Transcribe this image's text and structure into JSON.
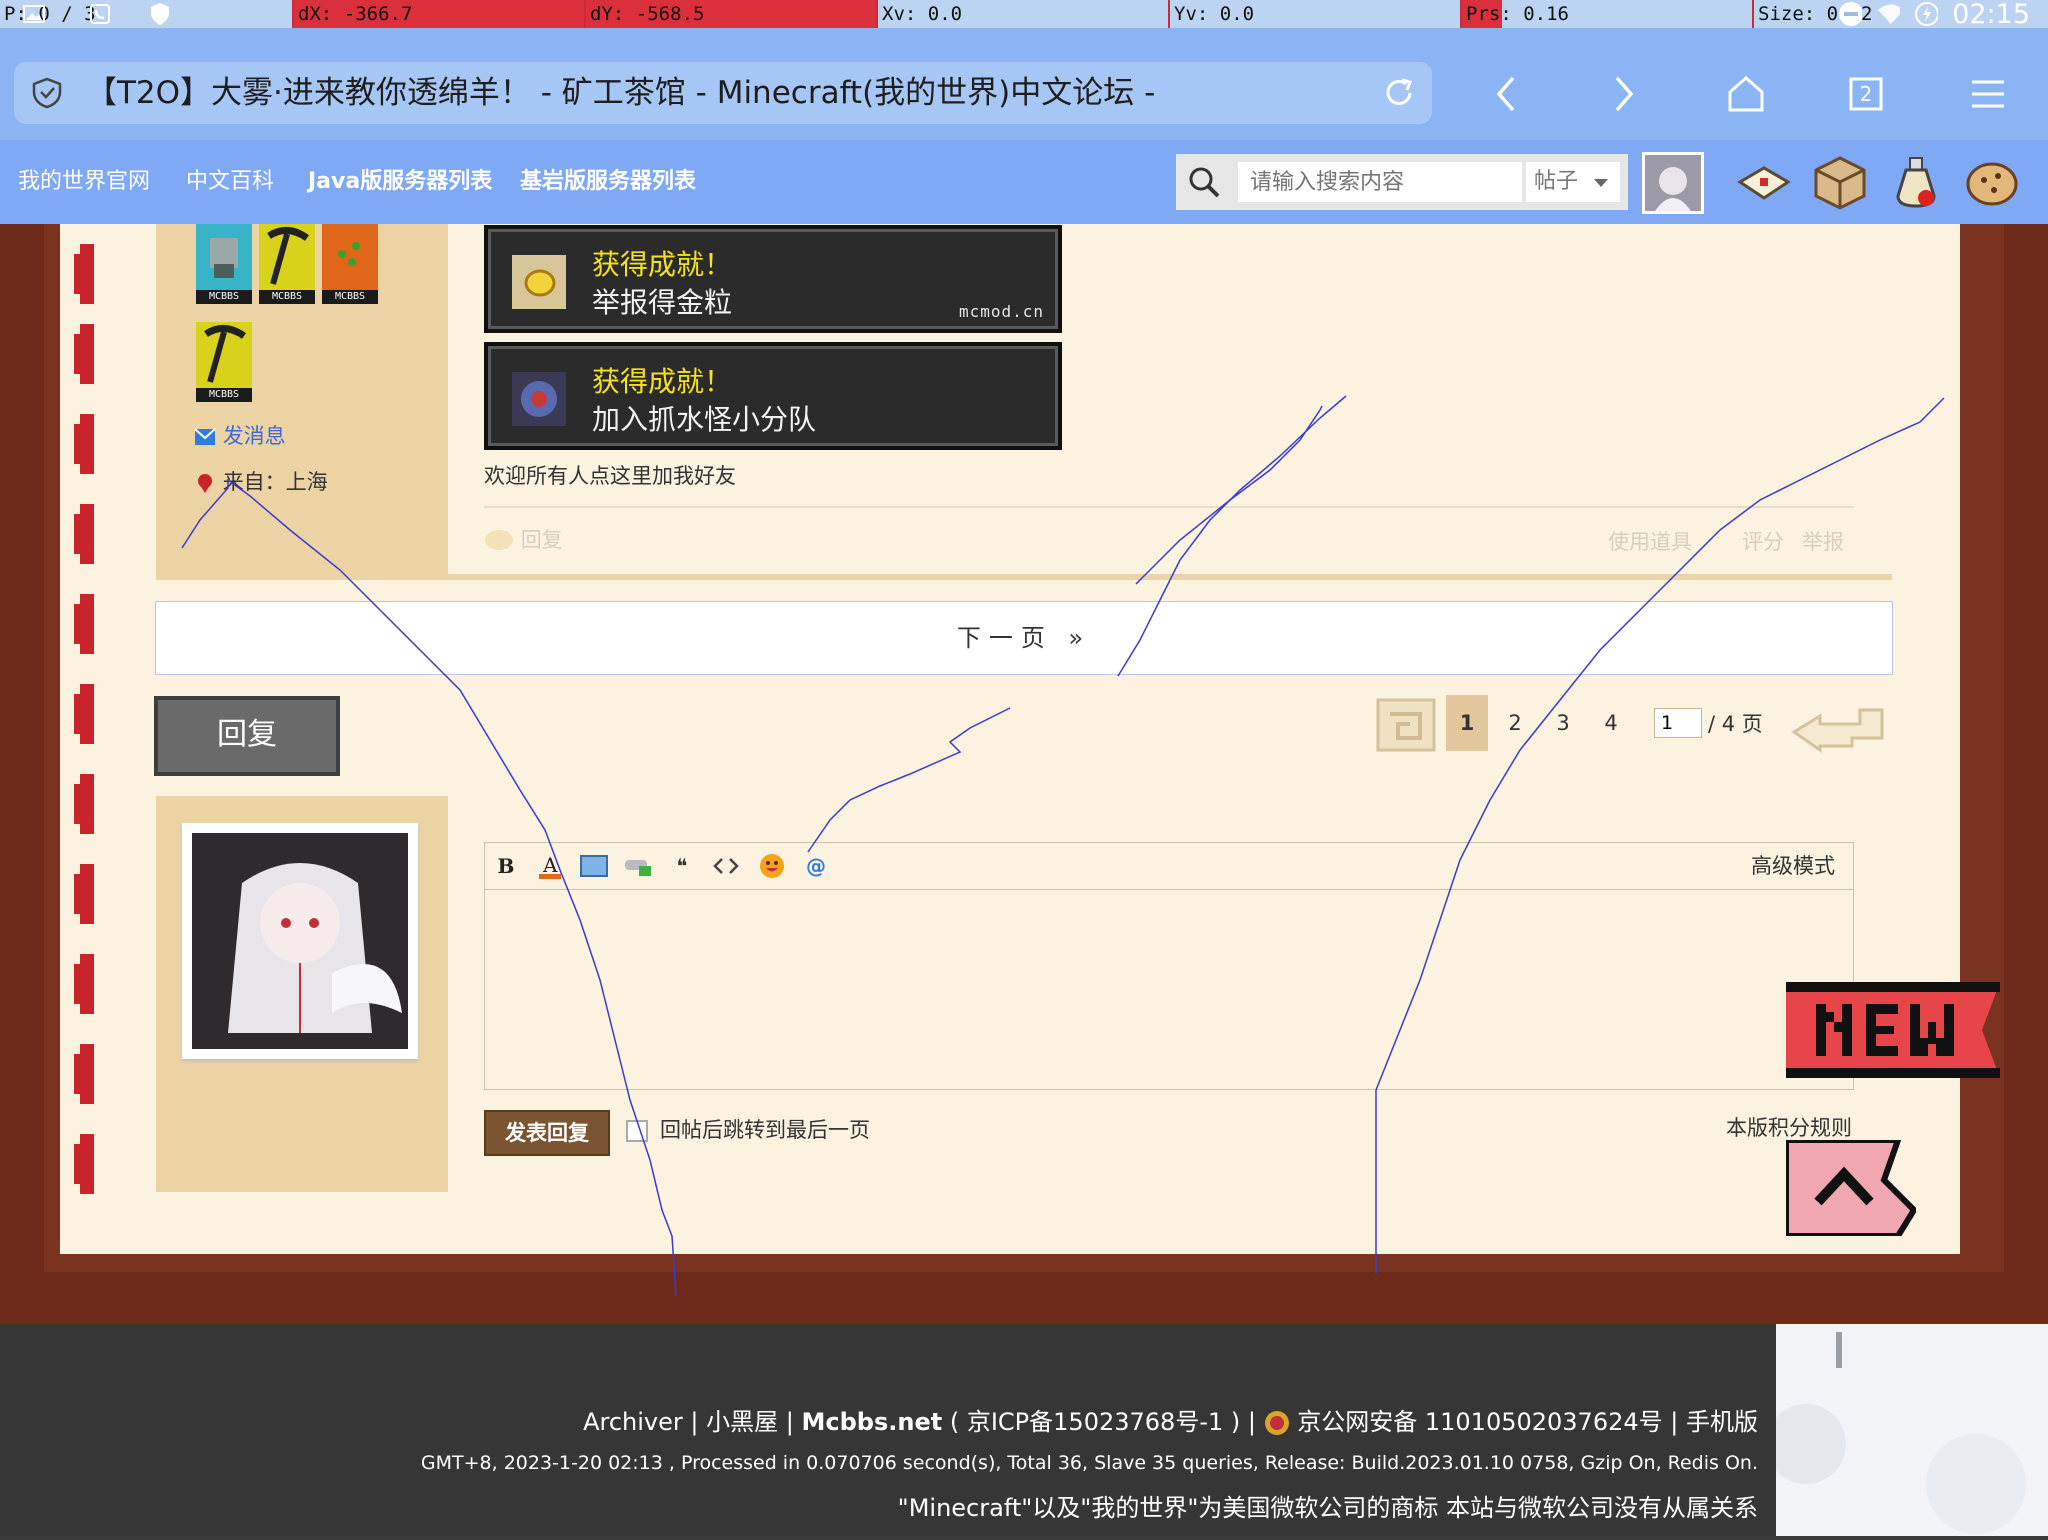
{
  "status_bar": {
    "pointer": "P: 0 / 3",
    "dx": "dX: -366.7",
    "dy": "dY: -568.5",
    "xv": "Xv: 0.0",
    "yv": "Yv: 0.0",
    "prs": "Prs: 0.16",
    "size": "Size: 0.02",
    "time": "02:15"
  },
  "browser": {
    "page_title": "【T2O】大雾·进来教你透绵羊！ - 矿工茶馆 - Minecraft(我的世界)中文论坛 -",
    "tab_count": "2",
    "icons": [
      "shield-icon",
      "reload-icon",
      "back-icon",
      "forward-icon",
      "home-icon",
      "tabs-icon",
      "menu-icon"
    ]
  },
  "site_nav": {
    "links": [
      "我的世界官网",
      "中文百科",
      "Java版服务器列表",
      "基岩版服务器列表"
    ],
    "search_placeholder": "请输入搜索内容",
    "search_type": "帖子"
  },
  "profile": {
    "badge_caption": "MCBBS",
    "send_message": "发消息",
    "from_label": "来自：上海"
  },
  "achievements": [
    {
      "title": "获得成就！",
      "desc": "举报得金粒",
      "site": "mcmod.cn"
    },
    {
      "title": "获得成就！",
      "desc": "加入抓水怪小分队"
    }
  ],
  "post": {
    "signature": "欢迎所有人点这里加我好友",
    "reply_link": "回复",
    "use_item": "使用道具",
    "rate": "评分",
    "report": "举报"
  },
  "pagination": {
    "next_page": "下一页 »",
    "pages": [
      "1",
      "2",
      "3",
      "4"
    ],
    "current_page": "1",
    "page_input": "1",
    "total": "/ 4 页"
  },
  "reply_button": "回复",
  "editor": {
    "advanced_mode": "高级模式",
    "toolbar": [
      "bold",
      "font-color",
      "image",
      "link",
      "quote",
      "code",
      "smiley",
      "at"
    ],
    "submit": "发表回复",
    "jump_last": "回帖后跳转到最后一页",
    "rules": "本版积分规则"
  },
  "footer": {
    "archiver": "Archiver",
    "sep": "|",
    "xiaoheiwu": "小黑屋",
    "mcbbs": "Mcbbs.net",
    "icp": "( 京ICP备15023768号-1 ) |",
    "police": "京公网安备 11010502037624号",
    "mobile": "| 手机版",
    "processed": "GMT+8, 2023-1-20 02:13 , Processed in 0.070706 second(s), Total 36, Slave 35 queries, Release: Build.2023.01.10 0758, Gzip On, Redis On.",
    "trademark": "\"Minecraft\"以及\"我的世界\"为美国微软公司的商标 本站与微软公司没有从属关系"
  },
  "colors": {
    "browser_bar": "#8ab4f3",
    "site_nav": "#7fa8f5",
    "frame": "#6e2a1a",
    "page": "#fbf3df",
    "profile_bg": "#ecd3a4",
    "achievement_title": "#f6e21a"
  }
}
